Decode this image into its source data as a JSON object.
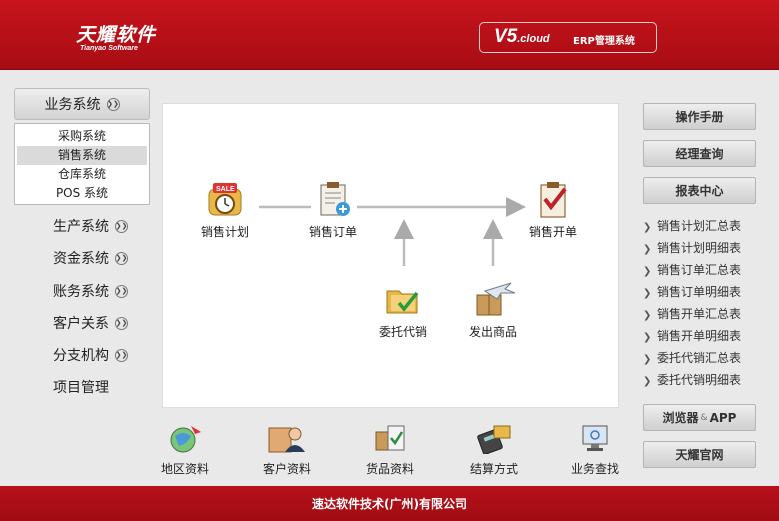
{
  "header": {
    "logo_cn": "天耀软件",
    "logo_en": "Tianyao Software",
    "version_main": "V5",
    "version_sub": ".cloud",
    "product": "ERP管理系统"
  },
  "sidebar": {
    "active_group": "业务系统",
    "submenu": [
      "采购系统",
      "销售系统",
      "仓库系统",
      "POS 系统"
    ],
    "selected_submenu": "销售系统",
    "items": [
      "生产系统",
      "资金系统",
      "账务系统",
      "客户关系",
      "分支机构",
      "项目管理"
    ]
  },
  "flow": {
    "sales_plan": "销售计划",
    "sales_order": "销售订单",
    "sales_invoice": "销售开单",
    "consignment": "委托代销",
    "shipped_goods": "发出商品"
  },
  "bottom": [
    "地区资料",
    "客户资料",
    "货品资料",
    "结算方式",
    "业务查找"
  ],
  "right": {
    "manual": "操作手册",
    "manager_query": "经理查询",
    "report_center": "报表中心",
    "reports": [
      "销售计划汇总表",
      "销售计划明细表",
      "销售订单汇总表",
      "销售订单明细表",
      "销售开单汇总表",
      "销售开单明细表",
      "委托代销汇总表",
      "委托代销明细表"
    ],
    "browser_left": "浏览器",
    "browser_amp": "&",
    "browser_right": "APP",
    "official_site": "天耀官网"
  },
  "footer": {
    "company": "速达软件技术(广州)有限公司"
  },
  "colors": {
    "brand_red": "#b7111a",
    "panel_gray": "#e9e9e9"
  }
}
